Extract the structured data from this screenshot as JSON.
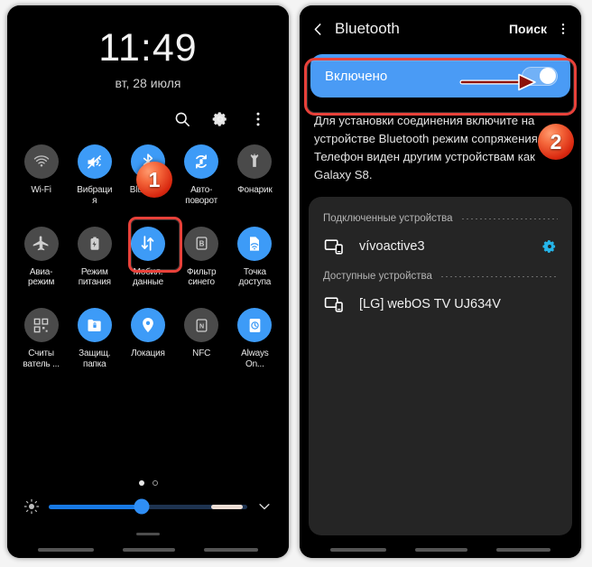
{
  "colors": {
    "accent_blue": "#3d9bf7",
    "toggle_blue": "#4a9bf5",
    "highlight_red": "#e8413a",
    "badge_orange": "#f4663a",
    "panel_bg": "#000000",
    "card_bg": "#252525",
    "tile_off": "#4a4a4a"
  },
  "left_panel": {
    "clock": "11:49",
    "date": "вт, 28 июля",
    "actions": [
      {
        "name": "search-icon",
        "label": "Поиск"
      },
      {
        "name": "gear-icon",
        "label": "Настройки"
      },
      {
        "name": "kebab-menu-icon",
        "label": "Ещё"
      }
    ],
    "tiles": [
      [
        {
          "label": "Wi-Fi",
          "icon": "wifi-icon",
          "on": false
        },
        {
          "label": "Вибраци\nя",
          "icon": "vibrate-icon",
          "on": true
        },
        {
          "label": "Bluetooth",
          "icon": "bluetooth-icon",
          "on": true
        },
        {
          "label": "Авто-\nповорот",
          "icon": "auto-rotate-icon",
          "on": true
        },
        {
          "label": "Фонарик",
          "icon": "flashlight-icon",
          "on": false
        }
      ],
      [
        {
          "label": "Авиа-\nрежим",
          "icon": "airplane-icon",
          "on": false
        },
        {
          "label": "Режим\nпитания",
          "icon": "power-mode-icon",
          "on": false
        },
        {
          "label": "Мобил.\nданные",
          "icon": "mobile-data-icon",
          "on": true
        },
        {
          "label": "Фильтр\nсинего",
          "icon": "blue-light-filter-icon",
          "on": false
        },
        {
          "label": "Точка\nдоступа",
          "icon": "hotspot-icon",
          "on": true
        }
      ],
      [
        {
          "label": "Считы\nватель ...",
          "icon": "qr-scanner-icon",
          "on": false
        },
        {
          "label": "Защищ.\nпапка",
          "icon": "secure-folder-icon",
          "on": true
        },
        {
          "label": "Локация",
          "icon": "location-pin-icon",
          "on": true
        },
        {
          "label": "NFC",
          "icon": "nfc-icon",
          "on": false
        },
        {
          "label": "Always\nOn...",
          "icon": "always-on-display-icon",
          "on": true
        }
      ]
    ],
    "pages": {
      "current": 1,
      "total": 2
    },
    "brightness": {
      "value_percent": 47,
      "icon": "brightness-icon",
      "expand_icon": "chevron-down-icon"
    }
  },
  "right_panel": {
    "back_icon": "chevron-left-icon",
    "title": "Bluetooth",
    "search_label": "Поиск",
    "kebab_icon": "kebab-menu-icon",
    "toggle": {
      "label": "Включено",
      "state": "on"
    },
    "description": "Для установки соединения включите на устройстве Bluetooth режим сопряжения. Телефон виден другим устройствам как Galaxy S8.",
    "groups": [
      {
        "title": "Подключенные устройства",
        "devices": [
          {
            "name": "vívoactive3",
            "icon": "device-tablet-phone-icon",
            "has_settings": true,
            "settings_icon": "gear-icon"
          }
        ]
      },
      {
        "title": "Доступные устройства",
        "devices": [
          {
            "name": "[LG] webOS TV UJ634V",
            "icon": "device-tablet-phone-icon",
            "has_settings": false
          }
        ]
      }
    ]
  },
  "annotations": {
    "badge_1": "1",
    "badge_2": "2",
    "highlight_bluetooth_tile": "Bluetooth tile highlighted",
    "highlight_toggle": "Bluetooth toggle row highlighted",
    "arrow_to_switch": "arrow pointing to switch"
  }
}
